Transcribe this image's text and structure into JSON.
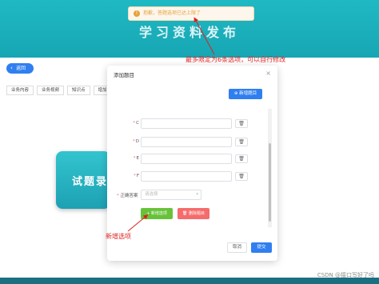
{
  "toast": {
    "text": "抱歉，答题选项已达上限了",
    "icon": "warning-icon"
  },
  "banner": {
    "title": "学习资料发布"
  },
  "back_button": {
    "label": "返回",
    "icon": "arrow-left-icon"
  },
  "page_tabs": [
    "业务内容",
    "业务视频",
    "知识点",
    "增加试题"
  ],
  "background_card": {
    "text": "试题录"
  },
  "dialog": {
    "title": "添加题目",
    "add_question_label": "新增题目",
    "add_question_icon": "plus-icon",
    "options": [
      {
        "letter": "C"
      },
      {
        "letter": "D"
      },
      {
        "letter": "E"
      },
      {
        "letter": "F"
      }
    ],
    "delete_icon": "trash-icon",
    "answer_label": "正确答案",
    "answer_placeholder": "请选择",
    "new_option_label": "+ 新增选项",
    "delete_question_label": "删除题目",
    "cancel_label": "取消",
    "confirm_label": "提交"
  },
  "annotations": {
    "top": "最多限定为6条选项，可以自行修改",
    "bottom": "新增选项"
  },
  "watermark": "CSDN @接口写好了吗",
  "colors": {
    "primary": "#2f7ff0",
    "success": "#67c23a",
    "danger": "#f56c6c",
    "banner": "#1fb9c3",
    "annotation": "#e02020"
  }
}
